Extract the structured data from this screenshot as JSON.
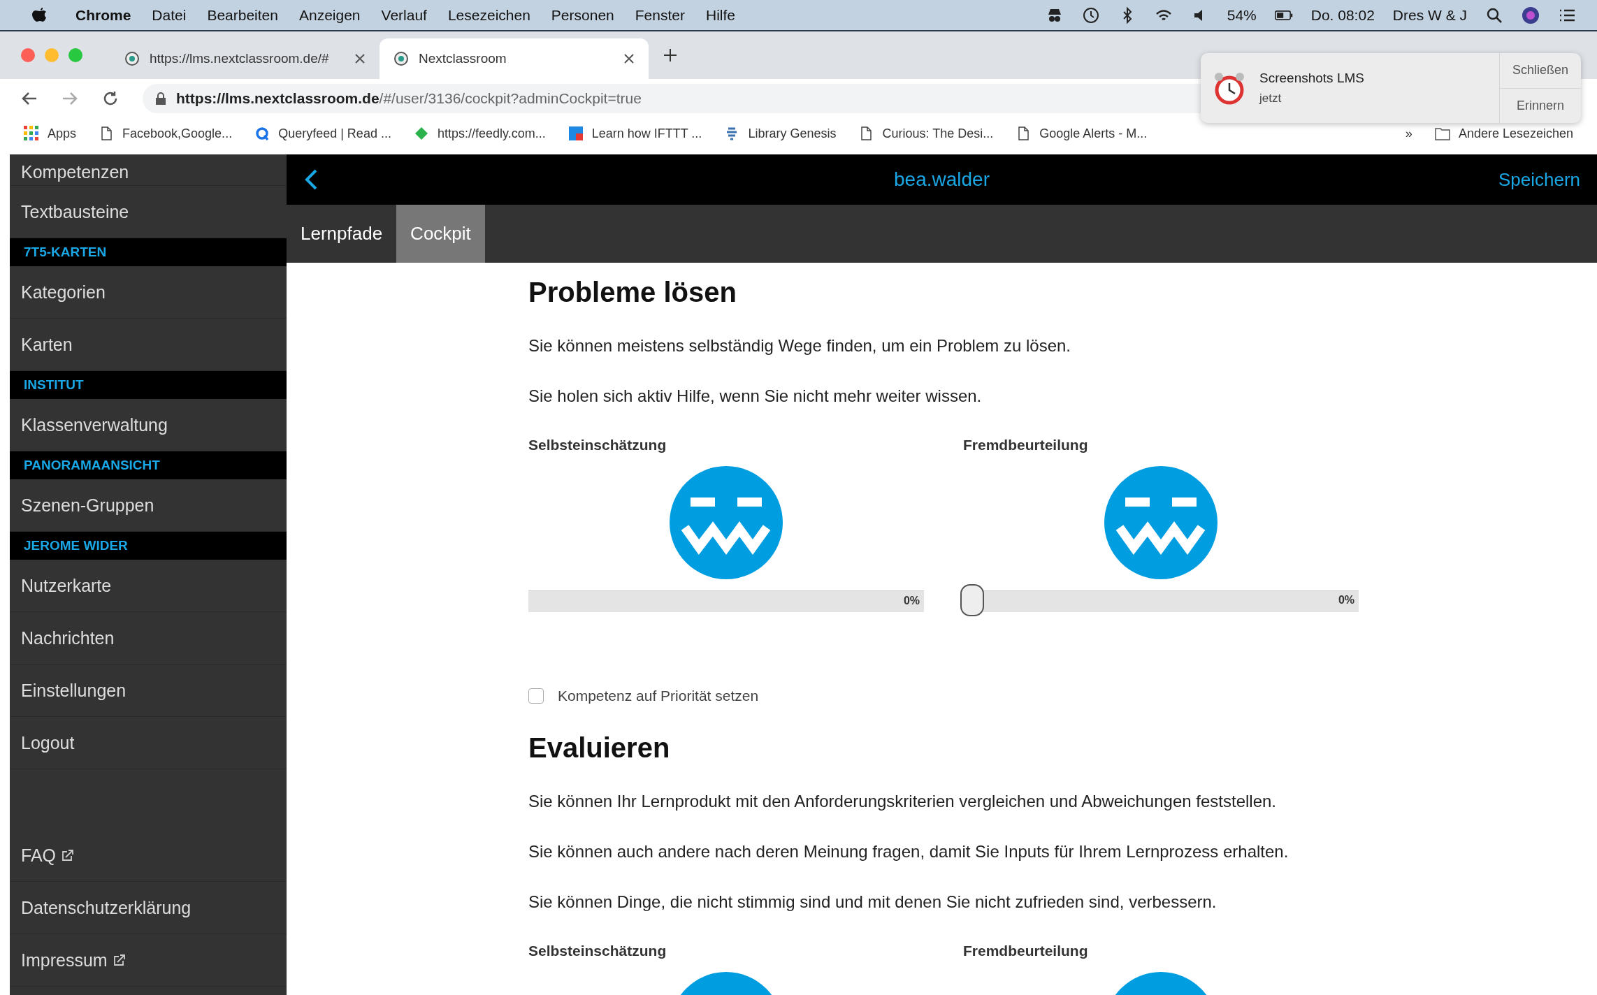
{
  "menu_bar": {
    "app": "Chrome",
    "items": [
      "Datei",
      "Bearbeiten",
      "Anzeigen",
      "Verlauf",
      "Lesezeichen",
      "Personen",
      "Fenster",
      "Hilfe"
    ],
    "battery": "54%",
    "clock": "Do. 08:02",
    "user": "Dres W & J"
  },
  "browser_tabs": [
    {
      "title": "https://lms.nextclassroom.de/#",
      "selected": false
    },
    {
      "title": "Nextclassroom",
      "selected": true
    }
  ],
  "address_bar": {
    "url": "**https://lms.nextclassroom.de**/#/user/3136/cockpit?adminCockpit=true"
  },
  "bookmarks": [
    {
      "title": "Apps",
      "kind": "apps"
    },
    {
      "title": "Facebook,Google...",
      "kind": "page"
    },
    {
      "title": "Queryfeed | Read ...",
      "kind": "query"
    },
    {
      "title": "https://feedly.com...",
      "kind": "feedly"
    },
    {
      "title": "Learn how IFTTT ...",
      "kind": "ifttt"
    },
    {
      "title": "Library Genesis",
      "kind": "library"
    },
    {
      "title": "Curious: The Desi...",
      "kind": "page"
    },
    {
      "title": "Google Alerts - M...",
      "kind": "page"
    }
  ],
  "bookmarks_more": "»",
  "other_bookmarks": "Andere Lesezeichen",
  "notification": {
    "title": "Screenshots LMS",
    "subtitle": "jetzt",
    "buttons": [
      "Schließen",
      "Erinnern"
    ]
  },
  "sidebar": {
    "items": [
      {
        "kind": "item",
        "label": "Kompetenzen"
      },
      {
        "kind": "item",
        "label": "Textbausteine"
      },
      {
        "kind": "header",
        "label": "7T5-KARTEN"
      },
      {
        "kind": "item",
        "label": "Kategorien"
      },
      {
        "kind": "item",
        "label": "Karten"
      },
      {
        "kind": "header",
        "label": "INSTITUT"
      },
      {
        "kind": "item",
        "label": "Klassenverwaltung"
      },
      {
        "kind": "header",
        "label": "PANORAMAANSICHT"
      },
      {
        "kind": "item",
        "label": "Szenen-Gruppen"
      },
      {
        "kind": "header",
        "label": "JEROME WIDER"
      },
      {
        "kind": "item",
        "label": "Nutzerkarte"
      },
      {
        "kind": "item",
        "label": "Nachrichten"
      },
      {
        "kind": "item",
        "label": "Einstellungen"
      },
      {
        "kind": "item",
        "label": "Logout"
      }
    ],
    "footer_items": [
      {
        "label": "FAQ",
        "external": true
      },
      {
        "label": "Datenschutzerklärung",
        "external": false
      },
      {
        "label": "Impressum",
        "external": true
      }
    ]
  },
  "app_header": {
    "title": "bea.walder",
    "action": "Speichern"
  },
  "tabs": [
    {
      "label": "Lernpfade",
      "selected": false
    },
    {
      "label": "Cockpit",
      "selected": true
    }
  ],
  "sections": [
    {
      "heading": "Probleme lösen",
      "statements": [
        "Sie können meistens selbständig Wege finden, um ein Problem zu lösen.",
        "Sie holen sich aktiv Hilfe, wenn Sie nicht mehr weiter wissen."
      ],
      "assessments": [
        {
          "label": "Selbsteinschätzung",
          "kind": "bar",
          "level": 0,
          "reading": "0%"
        },
        {
          "label": "Fremdbeurteilung",
          "kind": "slider",
          "level": 0,
          "reading": "0%"
        }
      ],
      "priority": {
        "label": "Kompetenz auf Priorität setzen",
        "checked": false
      }
    },
    {
      "heading": "Evaluieren",
      "statements": [
        "Sie können Ihr Lernprodukt mit den Anforderungskriterien vergleichen und Abweichungen feststellen.",
        "Sie können auch andere nach deren Meinung fragen, damit Sie Inputs für Ihrem Lernprozess erhalten.",
        "Sie können Dinge, die nicht stimmig sind und mit denen Sie nicht zufrieden sind, verbessern."
      ],
      "assessments": [
        {
          "label": "Selbsteinschätzung",
          "kind": "face"
        },
        {
          "label": "Fremdbeurteilung",
          "kind": "face"
        }
      ]
    }
  ]
}
